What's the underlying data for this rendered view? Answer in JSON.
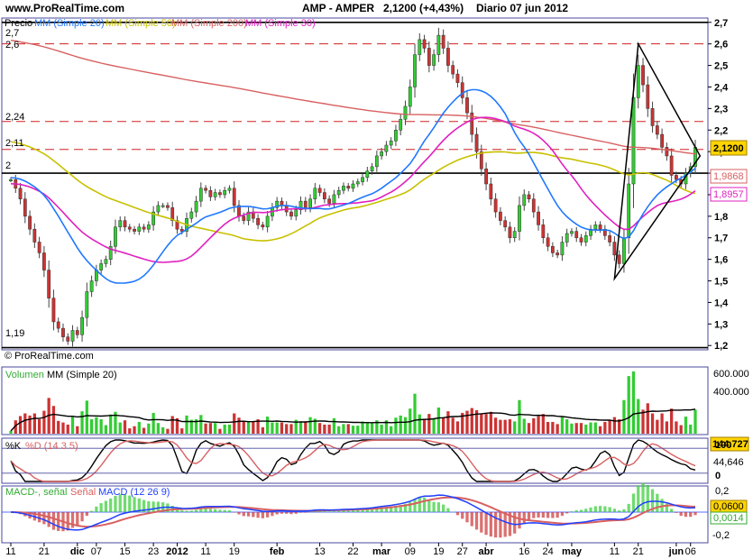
{
  "header": {
    "site": "www.ProRealTime.com",
    "ticker": "AMP - AMPER",
    "quote": "2,1200 (+4,43%)",
    "period": "Diario  07 jun 2012"
  },
  "colors": {
    "up": "#33cc33",
    "down": "#cc3333",
    "ma20": "#1f78ff",
    "ma50": "#c8c000",
    "ma200": "#d86060",
    "ma30": "#e020c0",
    "accent": "#ffd400",
    "frame": "#4a4aa0"
  },
  "price_panel": {
    "legend": [
      {
        "text": "Precio",
        "color": "#000000"
      },
      {
        "text": "MM (Simple 20)",
        "color": "#1f78ff"
      },
      {
        "text": "MM (Simple 50)",
        "color": "#c8c000"
      },
      {
        "text": "MM (Simple 200)",
        "color": "#d86060"
      },
      {
        "text": "MM (Simple 30)",
        "color": "#e020c0"
      }
    ],
    "watermark": "© ProRealTime.com",
    "level_labels": [
      "2,6",
      "2,24",
      "2,11",
      "2",
      "1,19",
      "2,7"
    ],
    "value_tags": [
      {
        "text": "2,1200",
        "value": 2.12,
        "fill": "#ffd400",
        "color": "#000000"
      },
      {
        "text": "1,9868",
        "value": 1.9868,
        "fill": "#ffffff",
        "color": "#d86060"
      },
      {
        "text": "1,8957",
        "value": 1.8957,
        "fill": "#ffffff",
        "color": "#e020c0"
      }
    ]
  },
  "volume_panel": {
    "legend": [
      {
        "text": "Volumen",
        "color": "#33aa33"
      },
      {
        "text": "MM (Simple 20)",
        "color": "#000000"
      }
    ],
    "axis_labels": [
      "600.000",
      "400.000"
    ],
    "value_tag": "144.727"
  },
  "stoch_panel": {
    "legend": [
      {
        "text": "%K",
        "color": "#000000"
      },
      {
        "text": "%D (14 3 5)",
        "color": "#d86060"
      }
    ],
    "axis_labels": [
      "100",
      "0"
    ],
    "value_tag": "44,646"
  },
  "macd_panel": {
    "legend": [
      {
        "text": "MACD-, señal",
        "color": "#33aa33"
      },
      {
        "text": "Señal",
        "color": "#d86060"
      },
      {
        "text": "MACD (12 26 9)",
        "color": "#1f3fff"
      }
    ],
    "axis_labels": [
      "0,2",
      "-0,2"
    ],
    "value_tags": [
      "0,0600",
      "0,0014"
    ]
  },
  "chart_data": {
    "type": "candlestick",
    "title": "AMP - AMPER",
    "ylim": [
      1.18,
      2.72
    ],
    "yticks": [
      "2,7",
      "2,6",
      "2,5",
      "2,4",
      "2,3",
      "2,2",
      "2,1",
      "2",
      "1,9",
      "1,8",
      "1,7",
      "1,6",
      "1,5",
      "1,4",
      "1,3",
      "1,2"
    ],
    "xticks": [
      {
        "label": "11",
        "i": 0
      },
      {
        "label": "21",
        "i": 7
      },
      {
        "label": "dic",
        "i": 14
      },
      {
        "label": "07",
        "i": 18
      },
      {
        "label": "15",
        "i": 24
      },
      {
        "label": "23",
        "i": 30
      },
      {
        "label": "2012",
        "i": 35
      },
      {
        "label": "11",
        "i": 41
      },
      {
        "label": "19",
        "i": 47
      },
      {
        "label": "feb",
        "i": 56
      },
      {
        "label": "13",
        "i": 65
      },
      {
        "label": "22",
        "i": 72
      },
      {
        "label": "mar",
        "i": 78
      },
      {
        "label": "09",
        "i": 84
      },
      {
        "label": "19",
        "i": 90
      },
      {
        "label": "27",
        "i": 95
      },
      {
        "label": "abr",
        "i": 100
      },
      {
        "label": "16",
        "i": 108
      },
      {
        "label": "24",
        "i": 113
      },
      {
        "label": "may",
        "i": 118
      },
      {
        "label": "11",
        "i": 127
      },
      {
        "label": "21",
        "i": 132
      },
      {
        "label": "jun",
        "i": 140
      },
      {
        "label": "06",
        "i": 143
      }
    ],
    "horizontal_levels": [
      {
        "value": 2.7,
        "style": "solid"
      },
      {
        "value": 2.6,
        "style": "dashed"
      },
      {
        "value": 2.24,
        "style": "dashed"
      },
      {
        "value": 2.11,
        "style": "dashed"
      },
      {
        "value": 2.0,
        "style": "solid"
      },
      {
        "value": 1.19,
        "style": "solid"
      }
    ],
    "triangle": [
      [
        127,
        1.51
      ],
      [
        132,
        2.6
      ],
      [
        145,
        2.08
      ]
    ],
    "close": [
      1.97,
      1.93,
      1.88,
      1.8,
      1.74,
      1.68,
      1.63,
      1.55,
      1.42,
      1.31,
      1.28,
      1.24,
      1.22,
      1.27,
      1.25,
      1.33,
      1.45,
      1.5,
      1.55,
      1.58,
      1.6,
      1.66,
      1.75,
      1.78,
      1.75,
      1.74,
      1.73,
      1.75,
      1.74,
      1.76,
      1.82,
      1.85,
      1.85,
      1.84,
      1.78,
      1.74,
      1.73,
      1.79,
      1.82,
      1.87,
      1.93,
      1.92,
      1.89,
      1.91,
      1.9,
      1.92,
      1.93,
      1.85,
      1.8,
      1.78,
      1.82,
      1.79,
      1.76,
      1.75,
      1.8,
      1.84,
      1.87,
      1.85,
      1.82,
      1.8,
      1.83,
      1.87,
      1.84,
      1.88,
      1.93,
      1.91,
      1.88,
      1.86,
      1.9,
      1.92,
      1.94,
      1.93,
      1.95,
      1.96,
      1.98,
      2.01,
      2.03,
      2.08,
      2.1,
      2.13,
      2.15,
      2.2,
      2.25,
      2.31,
      2.4,
      2.55,
      2.62,
      2.58,
      2.5,
      2.55,
      2.64,
      2.58,
      2.5,
      2.46,
      2.42,
      2.35,
      2.28,
      2.18,
      2.1,
      2.02,
      1.95,
      1.88,
      1.82,
      1.78,
      1.75,
      1.7,
      1.73,
      1.85,
      1.9,
      1.88,
      1.82,
      1.76,
      1.7,
      1.66,
      1.63,
      1.62,
      1.68,
      1.72,
      1.73,
      1.7,
      1.68,
      1.71,
      1.74,
      1.76,
      1.74,
      1.71,
      1.68,
      1.62,
      1.58,
      1.7,
      1.95,
      2.35,
      2.5,
      2.41,
      2.3,
      2.22,
      2.18,
      2.12,
      2.08,
      1.99,
      1.97,
      1.95,
      2.0,
      2.03,
      2.12
    ]
  }
}
